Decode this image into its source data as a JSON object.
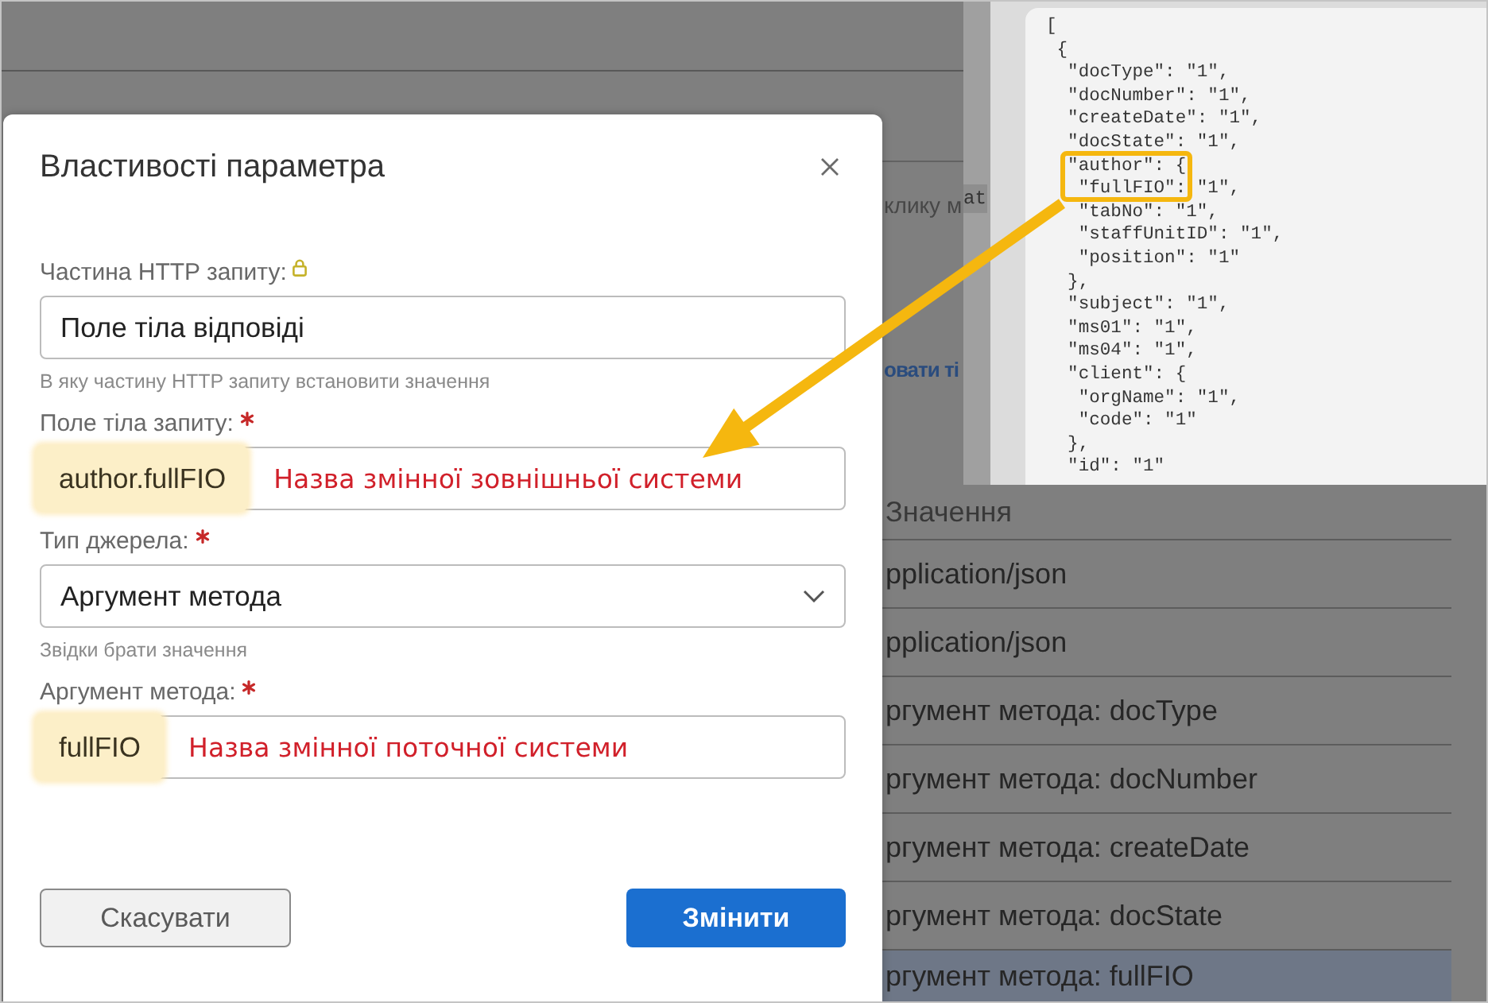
{
  "background_page": {
    "texts": [
      {
        "kind": "text",
        "text": "клику м"
      },
      {
        "kind": "link",
        "text": "овати ті"
      }
    ]
  },
  "table": {
    "columns": [
      {
        "label": "Значення"
      }
    ],
    "rows": [
      {
        "value": "pplication/json",
        "selected": false
      },
      {
        "value": "pplication/json",
        "selected": false
      },
      {
        "value": "ргумент метода: docType",
        "selected": false
      },
      {
        "value": "ргумент метода: docNumber",
        "selected": false
      },
      {
        "value": "ргумент метода: createDate",
        "selected": false
      },
      {
        "value": "ргумент метода: docState",
        "selected": false
      },
      {
        "value": "ргумент метода: fullFIO",
        "selected": true
      }
    ]
  },
  "code_inset": {
    "side_text": "at",
    "lines": [
      {
        "text": "[",
        "children": [
          {
            "text": "{",
            "children": [
              {
                "text": "\"docType\": \"1\","
              },
              {
                "text": "\"docNumber\": \"1\","
              },
              {
                "text": "\"createDate\": \"1\","
              },
              {
                "text": "\"docState\": \"1\","
              },
              {
                "text": "\"author\": {",
                "children": [
                  {
                    "text": "\"fullFIO\": \"1\","
                  },
                  {
                    "text": "\"tabNo\": \"1\","
                  },
                  {
                    "text": "\"staffUnitID\": \"1\","
                  },
                  {
                    "text": "\"position\": \"1\""
                  }
                ]
              },
              {
                "text": "},"
              },
              {
                "text": "\"subject\": \"1\","
              },
              {
                "text": "\"ms01\": \"1\","
              },
              {
                "text": "\"ms04\": \"1\","
              },
              {
                "text": "\"client\": {",
                "children": [
                  {
                    "text": "\"orgName\": \"1\","
                  },
                  {
                    "text": "\"code\": \"1\""
                  }
                ]
              },
              {
                "text": "},"
              },
              {
                "text": "\"id\": \"1\""
              }
            ]
          }
        ]
      }
    ]
  },
  "dialog": {
    "title": "Властивості параметра",
    "fields": [
      {
        "kind": "input",
        "label": "Частина HTTP запиту:",
        "locked": true,
        "required": false,
        "value": "Поле тіла відповіді",
        "highlighted": false,
        "hint": "В яку частину HTTP запиту встановити значення"
      },
      {
        "kind": "input",
        "label": "Поле тіла запиту:",
        "locked": false,
        "required": true,
        "value": "author.fullFIO",
        "highlighted": true,
        "annotation": "Назва змінної зовнішньої системи"
      },
      {
        "kind": "select",
        "label": "Тип джерела:",
        "locked": false,
        "required": true,
        "value": "Аргумент метода",
        "highlighted": false,
        "hint": "Звідки брати значення"
      },
      {
        "kind": "input",
        "label": "Аргумент метода:",
        "locked": false,
        "required": true,
        "value": "fullFIO",
        "highlighted": true,
        "annotation": "Назва змінної поточної системи"
      }
    ],
    "buttons": [
      {
        "kind": "secondary",
        "label": "Скасувати"
      },
      {
        "kind": "primary",
        "label": "Змінити"
      }
    ]
  }
}
